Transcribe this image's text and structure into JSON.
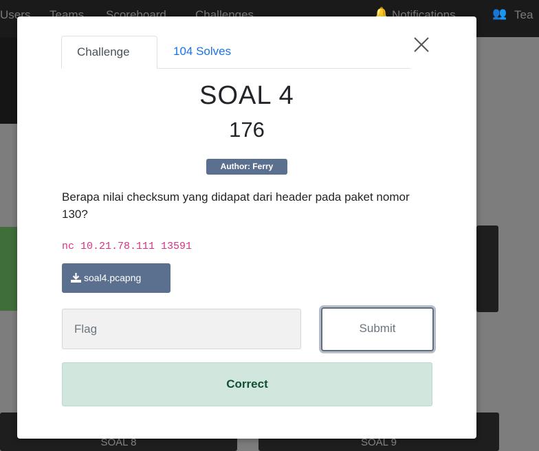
{
  "background": {
    "nav_links": [
      "Users",
      "Teams",
      "Scoreboard",
      "Challenges"
    ],
    "nav_right": [
      "Notifications",
      "Tea"
    ],
    "tiles": [
      "SOAL 8",
      "SOAL 9"
    ]
  },
  "modal": {
    "tabs": [
      {
        "label": "Challenge",
        "active": true
      },
      {
        "label": "104 Solves",
        "active": false
      }
    ],
    "title": "SOAL 4",
    "points": "176",
    "author_badge": "Author: Ferry",
    "description": "Berapa nilai checksum yang didapat dari header pada paket nomor 130?",
    "connection": "nc 10.21.78.111 13591",
    "file_button": "soal4.pcapng",
    "flag_input": {
      "value": "",
      "placeholder": "Flag"
    },
    "submit_label": "Submit",
    "result_message": "Correct"
  },
  "colors": {
    "accent_link": "#1a73e8",
    "badge_bg": "#5b6f8e",
    "success_bg": "#d1e7dd",
    "success_text": "#0f5132",
    "code_text": "#d63384"
  },
  "icons": {
    "close": "close-icon",
    "download": "download-icon",
    "bell": "bell-icon",
    "users": "users-icon"
  }
}
